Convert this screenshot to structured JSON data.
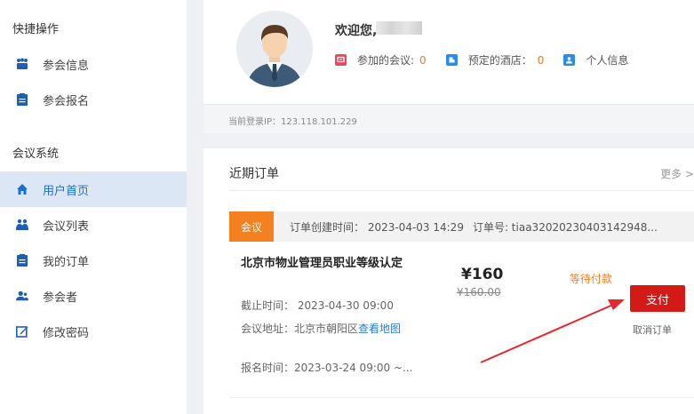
{
  "sidebar": {
    "quick_title": "快捷操作",
    "quick_items": [
      {
        "label": "参会信息",
        "icon": "attendees-icon"
      },
      {
        "label": "参会报名",
        "icon": "clipboard-icon"
      }
    ],
    "system_title": "会议系统",
    "system_items": [
      {
        "label": "用户首页",
        "icon": "home-icon",
        "active": true
      },
      {
        "label": "会议列表",
        "icon": "group-icon"
      },
      {
        "label": "我的订单",
        "icon": "clipboard-icon"
      },
      {
        "label": "参会者",
        "icon": "users-icon"
      },
      {
        "label": "修改密码",
        "icon": "edit-icon"
      }
    ]
  },
  "profile": {
    "welcome": "欢迎您,",
    "stats": [
      {
        "label": "参加的会议:",
        "value": "0",
        "icon": "meeting-icon",
        "color": "#e84a5f"
      },
      {
        "label": "预定的酒店：",
        "value": "0",
        "icon": "hotel-icon",
        "color": "#2b8be6"
      },
      {
        "label": "个人信息",
        "value": "",
        "icon": "person-icon",
        "color": "#2b8be6"
      }
    ],
    "ip_text": "当前登录IP：123.118.101.229"
  },
  "orders": {
    "title": "近期订单",
    "more": "更多 >",
    "items": [
      {
        "tag": "会议",
        "created": "订单创建时间： 2023-04-03 14:29",
        "order_no": "订单号: tiaa32020230403142948...",
        "name": "北京市物业管理员职业等级认定",
        "deadline": "截止时间： 2023-04-30 09:00",
        "address_label": "会议地址：北京市朝阳区",
        "map_link": "查看地图",
        "signup": "报名时间：2023-03-24 09:00 ~...",
        "price": "¥160",
        "price_old": "¥160.00",
        "status": "等待付款",
        "pay_label": "支付",
        "cancel_label": "取消订单"
      }
    ]
  },
  "colors": {
    "accent": "#1a6fd2",
    "tag": "#f5801f",
    "pay": "#d41a16",
    "arrow": "#e8262b"
  }
}
